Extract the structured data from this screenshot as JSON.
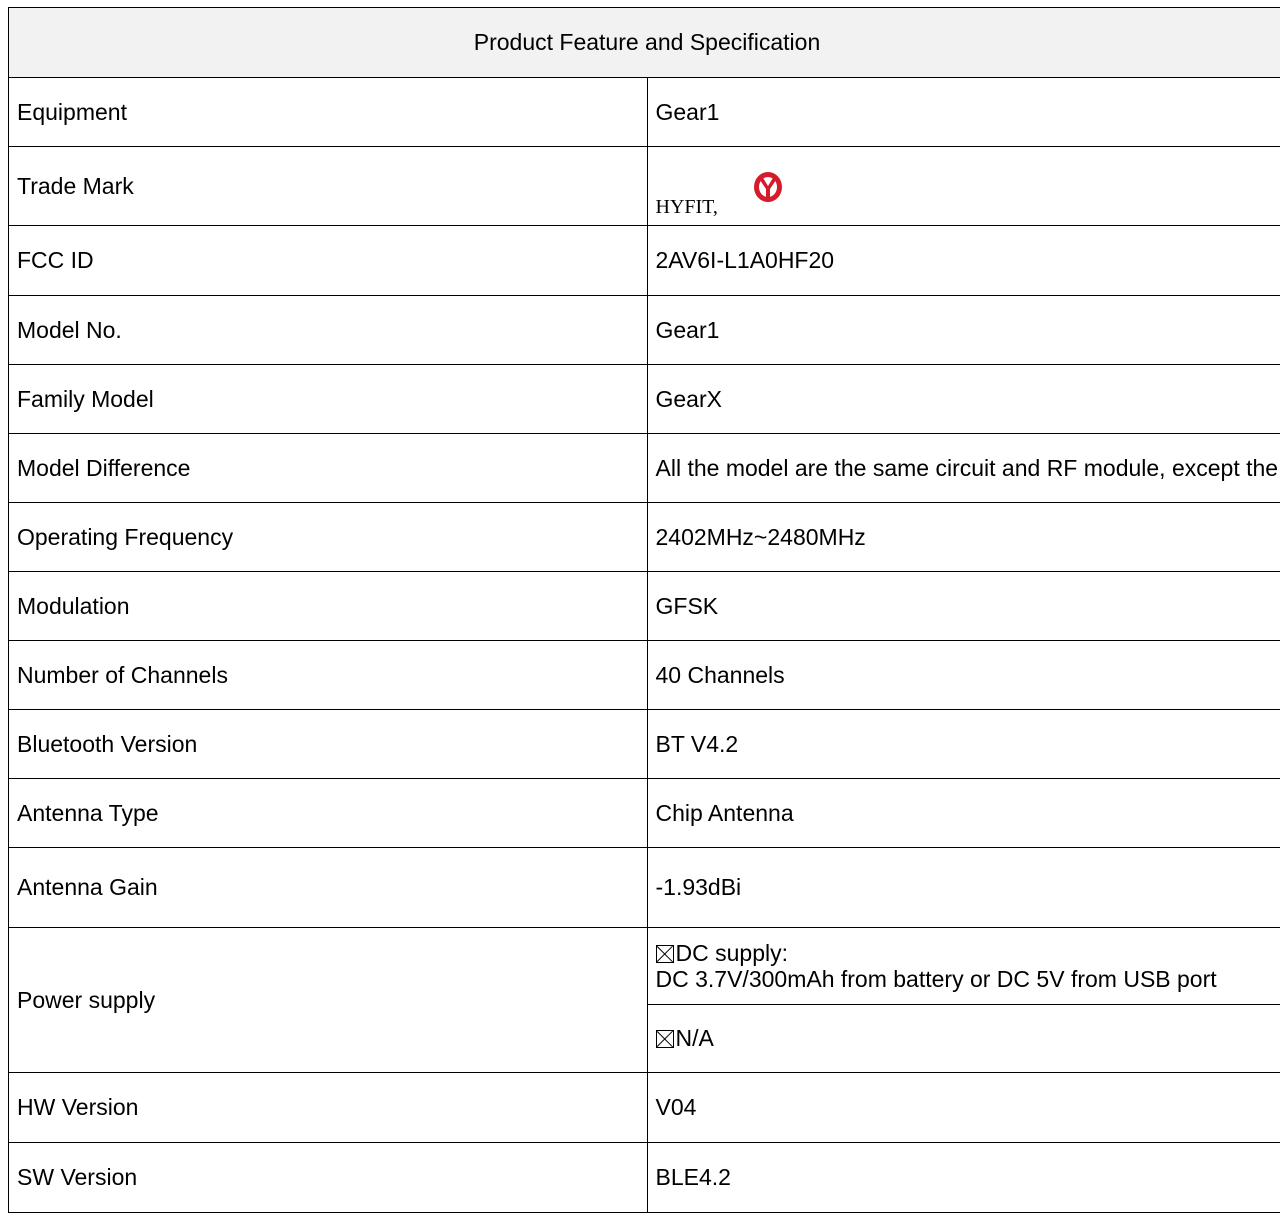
{
  "header": "Product Feature and Specification",
  "rows": [
    {
      "label": "Equipment",
      "value": "Gear1"
    },
    {
      "label": "Trade Mark",
      "value": "HYFIT,",
      "logo": "hyfit-y-logo",
      "logo_color": "#d41c2c"
    },
    {
      "label": "FCC ID",
      "value": "2AV6I-L1A0HF20"
    },
    {
      "label": "Model No.",
      "value": "Gear1"
    },
    {
      "label": "Family Model",
      "value": "GearX"
    },
    {
      "label": "Model Difference",
      "value": "All the model are the same circuit and RF module, except the color of appearance."
    },
    {
      "label": "Operating Frequency",
      "value": "2402MHz~2480MHz"
    },
    {
      "label": "Modulation",
      "value": "GFSK"
    },
    {
      "label": "Number of Channels",
      "value": "40 Channels"
    },
    {
      "label": "Bluetooth Version",
      "value": "BT V4.2"
    },
    {
      "label": "Antenna Type",
      "value": "Chip Antenna"
    },
    {
      "label": "Antenna Gain",
      "value": "-1.93dBi"
    }
  ],
  "power_supply": {
    "label": "Power supply",
    "dc_checkbox_icon": "checked-box-icon",
    "dc_title": "DC supply:",
    "dc_detail": "DC 3.7V/300mAh from battery or DC 5V from USB port",
    "na_label": "N/A"
  },
  "rows_after": [
    {
      "label": "HW Version",
      "value": "V04"
    },
    {
      "label": "SW Version",
      "value": "BLE4.2"
    }
  ]
}
